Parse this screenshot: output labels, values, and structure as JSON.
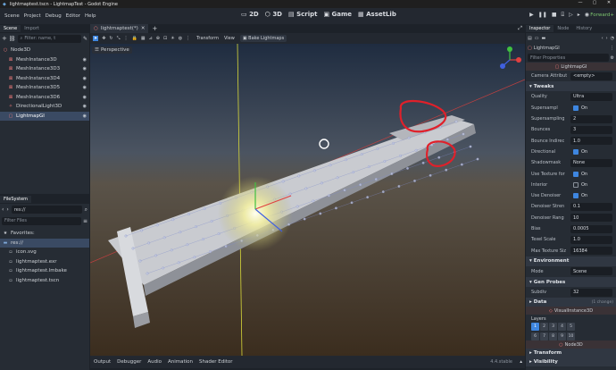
{
  "window": {
    "title": "lightmaptest.tscn - LightmapTest - Godot Engine",
    "controls": [
      "—",
      "▢",
      "✕"
    ]
  },
  "menu": [
    "Scene",
    "Project",
    "Debug",
    "Editor",
    "Help"
  ],
  "workspaces": [
    "2D",
    "3D",
    "Script",
    "Game",
    "AssetLib"
  ],
  "renderer": "Forward+",
  "scene_dock": {
    "tabs": [
      "Scene",
      "Import"
    ],
    "filter_placeholder": "Filter: name, t",
    "nodes": [
      {
        "label": "Node3D",
        "indent": 0,
        "icon": "node3d-icon"
      },
      {
        "label": "MeshInstance3D",
        "indent": 1,
        "icon": "mesh-icon"
      },
      {
        "label": "MeshInstance3D3",
        "indent": 1,
        "icon": "mesh-icon"
      },
      {
        "label": "MeshInstance3D4",
        "indent": 1,
        "icon": "mesh-icon"
      },
      {
        "label": "MeshInstance3D5",
        "indent": 1,
        "icon": "mesh-icon"
      },
      {
        "label": "MeshInstance3D6",
        "indent": 1,
        "icon": "mesh-icon"
      },
      {
        "label": "DirectionalLight3D",
        "indent": 1,
        "icon": "light-icon"
      },
      {
        "label": "LightmapGI",
        "indent": 1,
        "icon": "lightmap-icon",
        "selected": true
      }
    ]
  },
  "filesystem_dock": {
    "tab": "FileSystem",
    "path": "res://",
    "filter_placeholder": "Filter Files",
    "favorites_label": "Favorites:",
    "items": [
      {
        "label": "res://",
        "icon": "folder-icon",
        "selected": true
      },
      {
        "label": "icon.svg",
        "icon": "file-icon"
      },
      {
        "label": "lightmaptest.exr",
        "icon": "file-icon"
      },
      {
        "label": "lightmaptest.lmbake",
        "icon": "file-icon"
      },
      {
        "label": "lightmaptest.tscn",
        "icon": "file-icon"
      }
    ]
  },
  "editor_tab": "lightmaptest(*)",
  "viewport_toolbar": {
    "transform": "Transform",
    "view": "View",
    "bake": "Bake Lightmaps"
  },
  "viewport": {
    "perspective_label": "Perspective"
  },
  "bottom_tabs": [
    "Output",
    "Debugger",
    "Audio",
    "Animation",
    "Shader Editor"
  ],
  "version": "4.4.stable",
  "inspector": {
    "tabs": [
      "Inspector",
      "Node",
      "History"
    ],
    "node_name": "LightmapGI",
    "filter_placeholder": "Filter Properties",
    "class_header": "LightmapGI",
    "camera_attrib_label": "Camera Attribut",
    "camera_attrib_value": "<empty>",
    "sections": {
      "tweaks": "Tweaks",
      "environment": "Environment",
      "gen_probes": "Gen Probes",
      "data": "Data",
      "visual_instance": "VisualInstance3D",
      "layers": "Layers",
      "node3d": "Node3D",
      "transform": "Transform",
      "visibility": "Visibility"
    },
    "tweaks": [
      {
        "k": "Quality",
        "v": "Ultra"
      },
      {
        "k": "Supersampl",
        "v": "On",
        "check": true
      },
      {
        "k": "Supersampling",
        "v": "2"
      },
      {
        "k": "Bounces",
        "v": "3"
      },
      {
        "k": "Bounce Indirec",
        "v": "1.0"
      },
      {
        "k": "Directional",
        "v": "On",
        "check": true
      },
      {
        "k": "Shadowmask",
        "v": "None"
      },
      {
        "k": "Use Texture for",
        "v": "On",
        "check": true
      },
      {
        "k": "Interior",
        "v": "On",
        "check": false
      },
      {
        "k": "Use Denoiser",
        "v": "On",
        "check": true
      },
      {
        "k": "Denoiser Stren",
        "v": "0.1"
      },
      {
        "k": "Denoiser Rang",
        "v": "10"
      },
      {
        "k": "Bias",
        "v": "0.0005"
      },
      {
        "k": "Texel Scale",
        "v": "1.0"
      },
      {
        "k": "Max Texture Siz",
        "v": "16384"
      }
    ],
    "environment_mode_label": "Mode",
    "environment_mode_value": "Scene",
    "subdiv_label": "Subdiv",
    "subdiv_value": "32",
    "data_value": "(1 change)",
    "layer_numbers": [
      "1",
      "2",
      "3",
      "4",
      "5",
      "6",
      "7",
      "8",
      "9",
      "10"
    ]
  },
  "colors": {
    "accent": "#3e86e0",
    "annotation": "#e0202a",
    "renderer": "#7dc66f"
  }
}
